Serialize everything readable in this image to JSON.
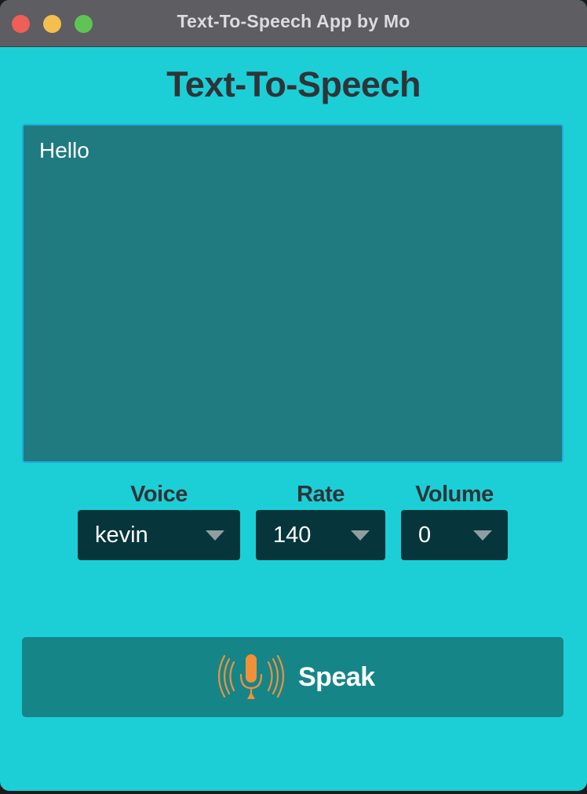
{
  "window": {
    "title": "Text-To-Speech App by Mo",
    "traffic_lights": {
      "close_color": "#ee5f57",
      "minimize_color": "#f5bf4f",
      "maximize_color": "#5fc454"
    }
  },
  "app": {
    "heading": "Text-To-Speech",
    "text_input": {
      "value": "Hello"
    },
    "controls": {
      "voice": {
        "label": "Voice",
        "selected": "kevin"
      },
      "rate": {
        "label": "Rate",
        "selected": "140"
      },
      "volume": {
        "label": "Volume",
        "selected": "0"
      }
    },
    "speak_button": {
      "label": "Speak",
      "icon": "microphone-broadcast-icon",
      "icon_color": "#f0913a"
    }
  },
  "colors": {
    "background": "#1ccfd6",
    "text_area_bg": "#1f7b80",
    "dropdown_bg": "#06363b",
    "button_bg": "#168588",
    "heading_text": "#2f3438"
  }
}
